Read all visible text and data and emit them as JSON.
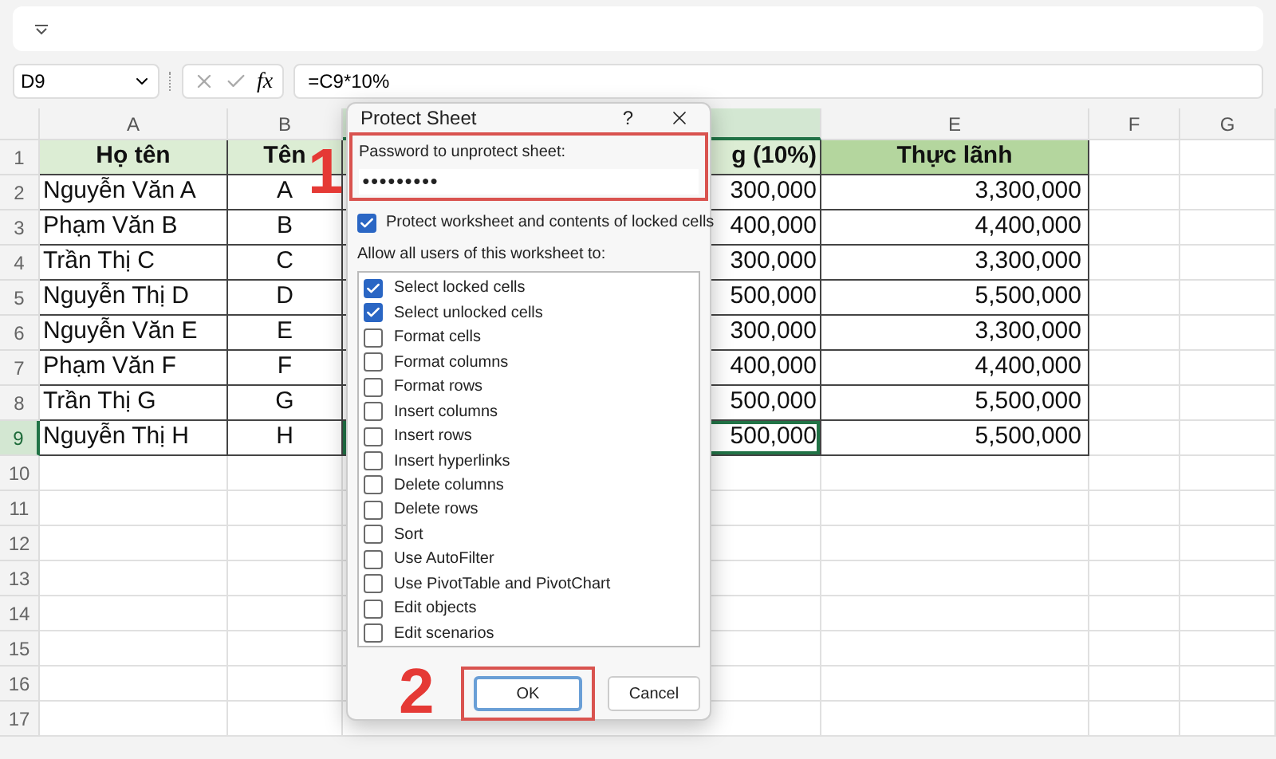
{
  "formula_bar": {
    "name_box": "D9",
    "formula": "=C9*10%"
  },
  "fx_label": "fx",
  "column_headers": [
    {
      "label": "A",
      "selected": false
    },
    {
      "label": "B",
      "selected": false
    },
    {
      "selected": true
    },
    {
      "label": "E",
      "selected": false
    },
    {
      "label": "F",
      "selected": false
    },
    {
      "label": "G",
      "selected": false
    }
  ],
  "table": {
    "header": {
      "name": "Họ tên",
      "ten": "Tên",
      "d": "g (10%)",
      "e": "Thực lãnh"
    },
    "rows": [
      {
        "num": "2",
        "name": "Nguyễn Văn A",
        "ten": "A",
        "d": "300,000",
        "e": "3,300,000",
        "selected": false
      },
      {
        "num": "3",
        "name": "Phạm Văn B",
        "ten": "B",
        "d": "400,000",
        "e": "4,400,000",
        "selected": false
      },
      {
        "num": "4",
        "name": "Trần Thị C",
        "ten": "C",
        "d": "300,000",
        "e": "3,300,000",
        "selected": false
      },
      {
        "num": "5",
        "name": "Nguyễn Thị D",
        "ten": "D",
        "d": "500,000",
        "e": "5,500,000",
        "selected": false
      },
      {
        "num": "6",
        "name": "Nguyễn Văn E",
        "ten": "E",
        "d": "300,000",
        "e": "3,300,000",
        "selected": false
      },
      {
        "num": "7",
        "name": "Phạm Văn F",
        "ten": "F",
        "d": "400,000",
        "e": "4,400,000",
        "selected": false
      },
      {
        "num": "8",
        "name": "Trần Thị G",
        "ten": "G",
        "d": "500,000",
        "e": "5,500,000",
        "selected": false
      },
      {
        "num": "9",
        "name": "Nguyễn Thị H",
        "ten": "H",
        "d": "500,000",
        "e": "5,500,000",
        "selected": true
      }
    ]
  },
  "header_row_num": "1",
  "empty_rows": [
    "10",
    "11",
    "12",
    "13",
    "14",
    "15",
    "16",
    "17"
  ],
  "dialog": {
    "title": "Protect Sheet",
    "help": "?",
    "password_label": "Password to unprotect sheet:",
    "password_value": "●●●●●●●●●",
    "protect": {
      "label": "Protect worksheet and contents of locked cells",
      "checked": true
    },
    "allow_label": "Allow all users of this worksheet to:",
    "permissions": [
      {
        "label": "Select locked cells",
        "checked": true
      },
      {
        "label": "Select unlocked cells",
        "checked": true
      },
      {
        "label": "Format cells",
        "checked": false
      },
      {
        "label": "Format columns",
        "checked": false
      },
      {
        "label": "Format rows",
        "checked": false
      },
      {
        "label": "Insert columns",
        "checked": false
      },
      {
        "label": "Insert rows",
        "checked": false
      },
      {
        "label": "Insert hyperlinks",
        "checked": false
      },
      {
        "label": "Delete columns",
        "checked": false
      },
      {
        "label": "Delete rows",
        "checked": false
      },
      {
        "label": "Sort",
        "checked": false
      },
      {
        "label": "Use AutoFilter",
        "checked": false
      },
      {
        "label": "Use PivotTable and PivotChart",
        "checked": false
      },
      {
        "label": "Edit objects",
        "checked": false
      },
      {
        "label": "Edit scenarios",
        "checked": false
      }
    ],
    "buttons": [
      "OK",
      "Cancel"
    ]
  },
  "annotations": [
    "1",
    "2"
  ]
}
